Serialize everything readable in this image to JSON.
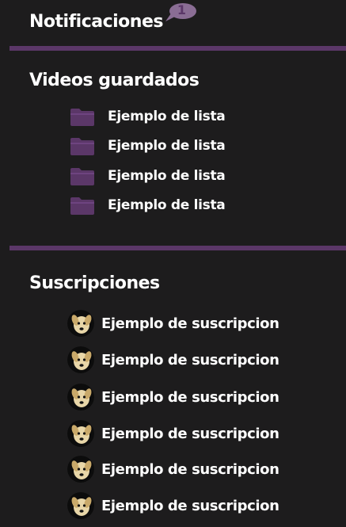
{
  "notifications": {
    "title": "Notificaciones",
    "badge_count": "1"
  },
  "saved_videos": {
    "title": "Videos guardados",
    "items": [
      {
        "label": "Ejemplo de lista",
        "icon": "folder-icon"
      },
      {
        "label": "Ejemplo de lista",
        "icon": "folder-icon"
      },
      {
        "label": "Ejemplo de lista",
        "icon": "folder-icon"
      },
      {
        "label": "Ejemplo de lista",
        "icon": "folder-icon"
      }
    ]
  },
  "subscriptions": {
    "title": "Suscripciones",
    "items": [
      {
        "label": "Ejemplo de suscripcion",
        "icon": "dog-avatar-icon"
      },
      {
        "label": "Ejemplo de suscripcion",
        "icon": "dog-avatar-icon"
      },
      {
        "label": "Ejemplo de suscripcion",
        "icon": "dog-avatar-icon"
      },
      {
        "label": "Ejemplo de suscripcion",
        "icon": "dog-avatar-icon"
      },
      {
        "label": "Ejemplo de suscripcion",
        "icon": "dog-avatar-icon"
      },
      {
        "label": "Ejemplo de suscripcion",
        "icon": "dog-avatar-icon"
      }
    ]
  },
  "colors": {
    "background": "#1d1c1d",
    "accent": "#5b3768",
    "badge": "#8a6d94",
    "text": "#ffffff"
  }
}
